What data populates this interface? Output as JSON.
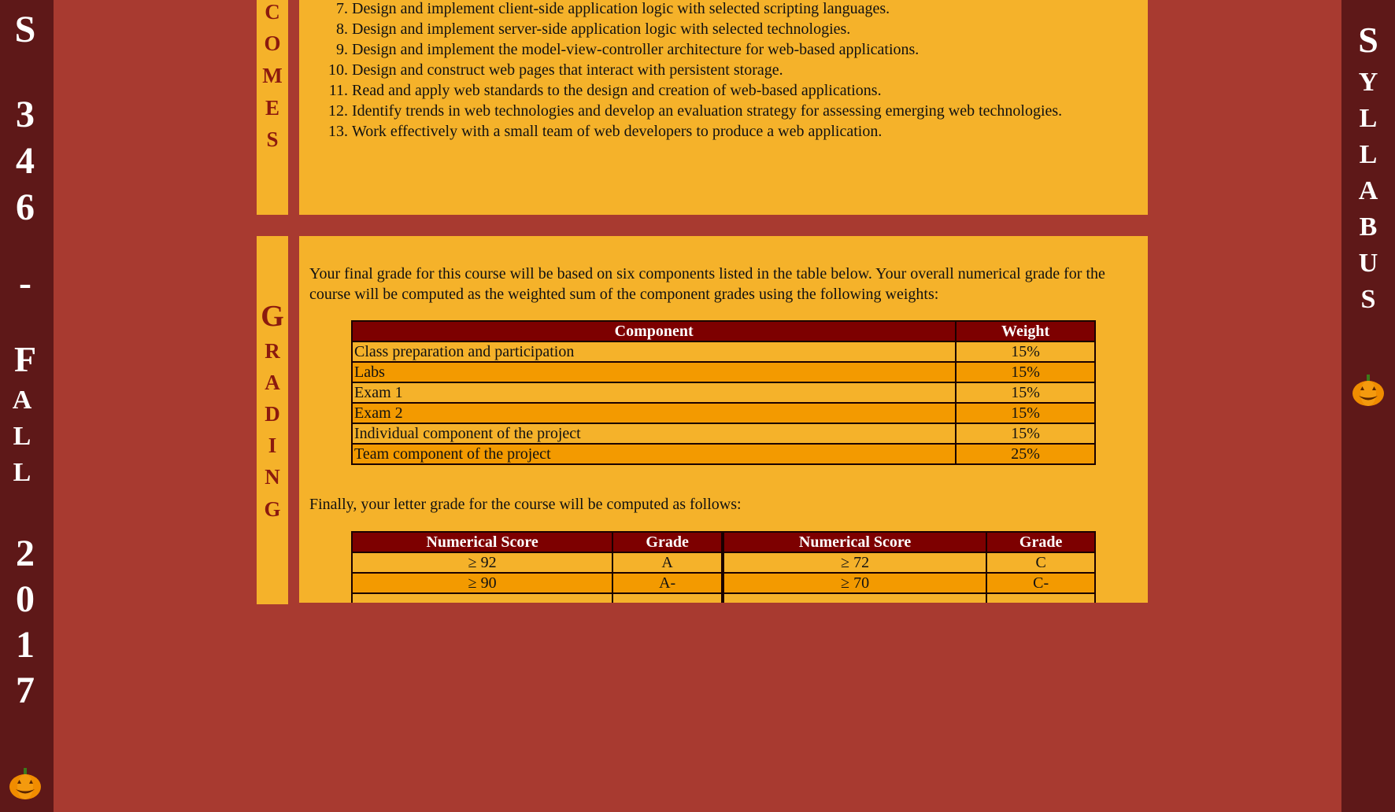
{
  "left_banner": {
    "chars": [
      "S",
      "3",
      "4",
      "6",
      "-",
      "F",
      "A",
      "L",
      "L",
      "2",
      "0",
      "1",
      "7"
    ]
  },
  "right_banner": {
    "chars": [
      "S",
      "Y",
      "L",
      "L",
      "A",
      "B",
      "U",
      "S"
    ]
  },
  "pumpkin_icon": "jack-o-lantern",
  "outcomes_section": {
    "label_chars": [
      "C",
      "O",
      "M",
      "E",
      "S"
    ],
    "items": [
      {
        "num": "7.",
        "text": "Design and implement client-side application logic with selected scripting languages."
      },
      {
        "num": "8.",
        "text": "Design and implement server-side application logic with selected technologies."
      },
      {
        "num": "9.",
        "text": "Design and implement the model-view-controller architecture for web-based applications."
      },
      {
        "num": "10.",
        "text": "Design and construct web pages that interact with persistent storage."
      },
      {
        "num": "11.",
        "text": "Read and apply web standards to the design and creation of web-based applications."
      },
      {
        "num": "12.",
        "text": "Identify trends in web technologies and develop an evaluation strategy for assessing emerging web technologies."
      },
      {
        "num": "13.",
        "text": "Work effectively with a small team of web developers to produce a web application."
      }
    ]
  },
  "grading_section": {
    "label_chars": [
      "G",
      "R",
      "A",
      "D",
      "I",
      "N",
      "G"
    ],
    "intro": "Your final grade for this course will be based on six components listed in the table below. Your overall numerical grade for the course will be computed as the weighted sum of the component grades using the following weights:",
    "weights_table": {
      "headers": [
        "Component",
        "Weight"
      ],
      "rows": [
        [
          "Class preparation and participation",
          "15%"
        ],
        [
          "Labs",
          "15%"
        ],
        [
          "Exam 1",
          "15%"
        ],
        [
          "Exam 2",
          "15%"
        ],
        [
          "Individual component of the project",
          "15%"
        ],
        [
          "Team component of the project",
          "25%"
        ]
      ]
    },
    "letter_intro": "Finally, your letter grade for the course will be computed as follows:",
    "letter_table": {
      "headers": [
        "Numerical Score",
        "Grade",
        "Numerical Score",
        "Grade"
      ],
      "rows": [
        [
          "≥ 92",
          "A",
          "≥ 72",
          "C"
        ],
        [
          "≥ 90",
          "A-",
          "≥ 70",
          "C-"
        ]
      ]
    }
  },
  "colors": {
    "background": "#a83a30",
    "side_bar": "#5e1818",
    "panel": "#f5b22a",
    "row_alt": "#f39a00",
    "table_header": "#7d0000",
    "label_text": "#8b1a0e"
  }
}
